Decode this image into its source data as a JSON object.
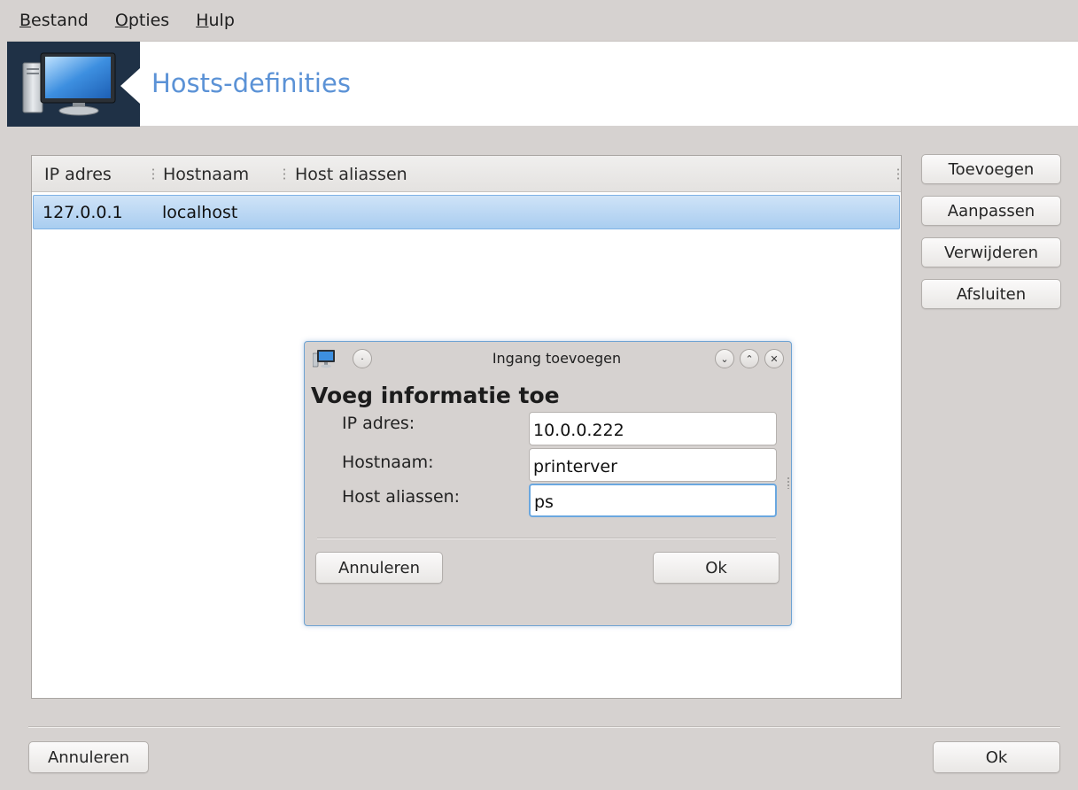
{
  "menubar": {
    "items": [
      {
        "mnemonic": "B",
        "rest": "estand"
      },
      {
        "mnemonic": "O",
        "rest": "pties"
      },
      {
        "mnemonic": "H",
        "rest": "ulp"
      }
    ]
  },
  "banner": {
    "title": "Hosts-definities",
    "icon": "computer-monitor-icon"
  },
  "hosts_table": {
    "columns": [
      "IP adres",
      "Hostnaam",
      "Host aliassen"
    ],
    "rows": [
      {
        "ip": "127.0.0.1",
        "hostname": "localhost",
        "aliases": ""
      }
    ]
  },
  "side_buttons": {
    "add": "Toevoegen",
    "modify": "Aanpassen",
    "remove": "Verwijderen",
    "close": "Afsluiten"
  },
  "footer": {
    "cancel": "Annuleren",
    "ok": "Ok"
  },
  "dialog": {
    "title": "Ingang toevoegen",
    "heading": "Voeg informatie toe",
    "fields": {
      "ip": {
        "label": "IP adres:",
        "value": "10.0.0.222"
      },
      "hostname": {
        "label": "Hostnaam:",
        "value": "printerver"
      },
      "aliases": {
        "label": "Host aliassen:",
        "value": "ps"
      }
    },
    "cancel": "Annuleren",
    "ok": "Ok"
  },
  "colors": {
    "accent": "#5b92d6",
    "banner_dark": "#1f3146",
    "selection": "#a9cdf0",
    "focus": "#6aa7df"
  }
}
